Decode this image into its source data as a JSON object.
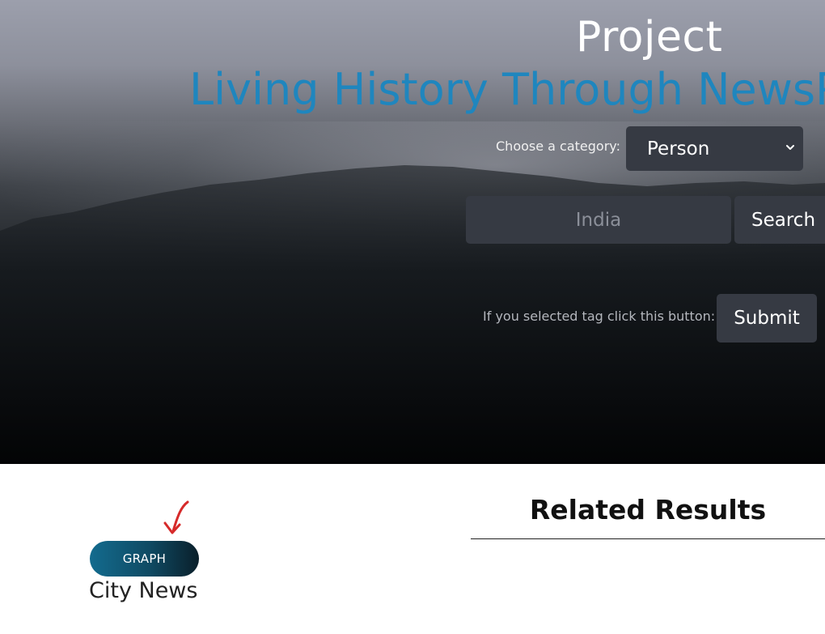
{
  "hero": {
    "title": "Project",
    "subtitle": "Living History Through NewsP"
  },
  "category": {
    "label": "Choose a category:",
    "selected": "Person"
  },
  "search": {
    "placeholder": "India",
    "button_label": "Search"
  },
  "tag_submit": {
    "label": "If you selected tag click this button:",
    "button_label": "Submit"
  },
  "graph": {
    "button_label": "GRAPH",
    "caption": "City News"
  },
  "related": {
    "title": "Related Results"
  },
  "colors": {
    "subtitle": "#1f86be",
    "control_bg": "#363a43",
    "graph_gradient_start": "#136b8e",
    "graph_gradient_end": "#0a1f2a",
    "annotation_arrow": "#d62a2a"
  },
  "icons": {
    "dropdown": "chevron-down-icon",
    "annotation": "hand-drawn-arrow-icon"
  }
}
